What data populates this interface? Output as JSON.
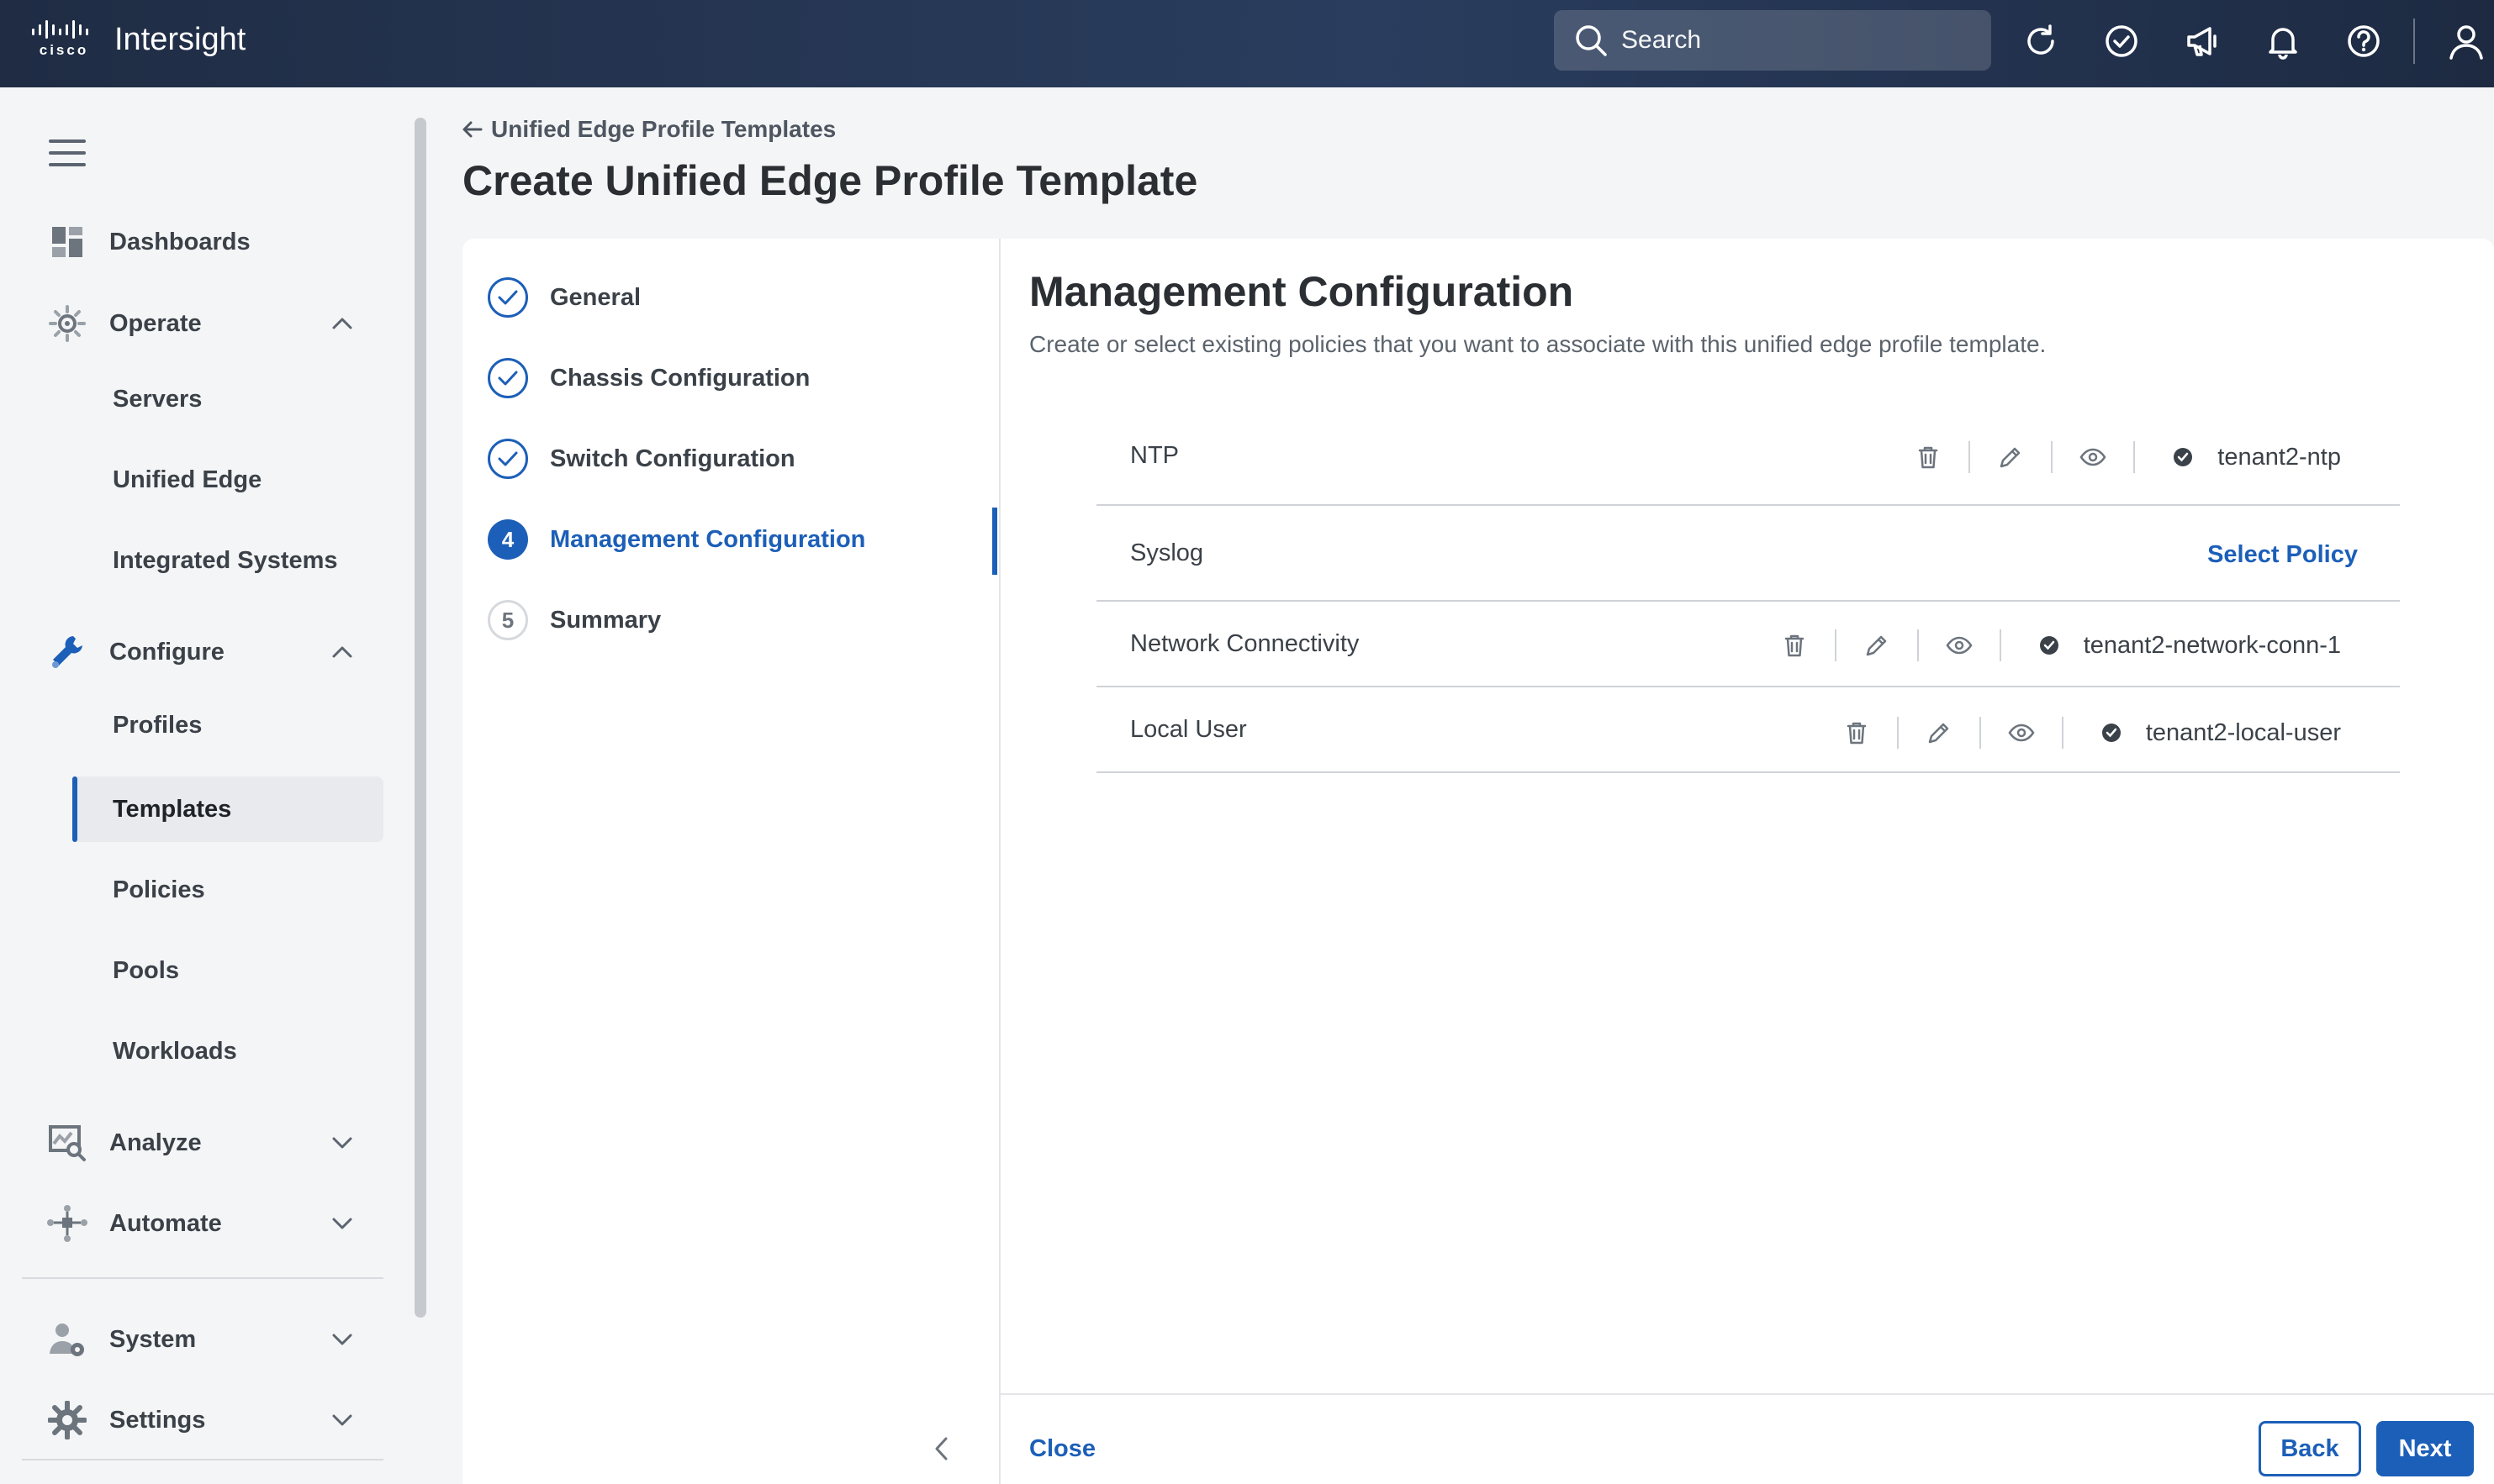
{
  "header": {
    "brand": "cisco",
    "app_name": "Intersight",
    "search_placeholder": "Search"
  },
  "sidebar": {
    "items": [
      {
        "label": "Dashboards"
      },
      {
        "label": "Operate"
      },
      {
        "label": "Servers"
      },
      {
        "label": "Unified Edge"
      },
      {
        "label": "Integrated Systems"
      },
      {
        "label": "Configure"
      },
      {
        "label": "Profiles"
      },
      {
        "label": "Templates",
        "active": true
      },
      {
        "label": "Policies"
      },
      {
        "label": "Pools"
      },
      {
        "label": "Workloads"
      },
      {
        "label": "Analyze"
      },
      {
        "label": "Automate"
      },
      {
        "label": "System"
      },
      {
        "label": "Settings"
      }
    ]
  },
  "page": {
    "breadcrumb": "Unified Edge Profile Templates",
    "title": "Create Unified Edge Profile Template"
  },
  "steps": [
    {
      "label": "General",
      "state": "done"
    },
    {
      "label": "Chassis Configuration",
      "state": "done"
    },
    {
      "label": "Switch Configuration",
      "state": "done"
    },
    {
      "label": "Management Configuration",
      "state": "active",
      "number": "4"
    },
    {
      "label": "Summary",
      "state": "todo",
      "number": "5"
    }
  ],
  "main": {
    "title": "Management Configuration",
    "description": "Create or select existing policies that you want to associate with this unified edge profile template.",
    "policies": [
      {
        "name": "NTP",
        "value": "tenant2-ntp"
      },
      {
        "name": "Syslog",
        "action": "Select Policy"
      },
      {
        "name": "Network Connectivity",
        "value": "tenant2-network-conn-1"
      },
      {
        "name": "Local User",
        "value": "tenant2-local-user"
      }
    ]
  },
  "footer": {
    "close_label": "Close",
    "back_label": "Back",
    "next_label": "Next"
  },
  "colors": {
    "accent": "#1c5fb8",
    "topbar": "#2a3d5e",
    "text": "#2b2f33"
  }
}
